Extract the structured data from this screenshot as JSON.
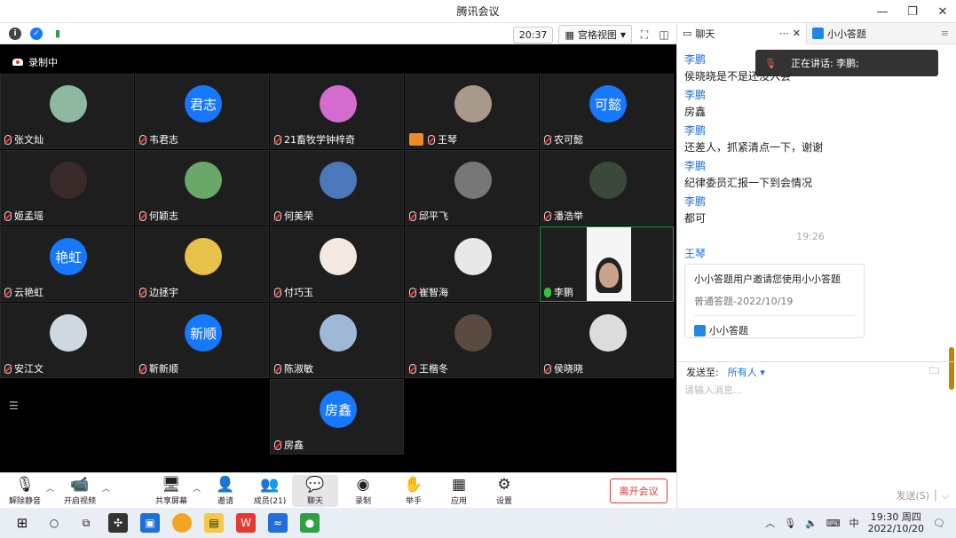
{
  "window": {
    "title": "腾讯会议"
  },
  "toolbar": {
    "time": "20:37",
    "view_label": "宫格视图"
  },
  "recording": {
    "label": "录制中"
  },
  "participants": [
    {
      "name": "张文灿",
      "avatar_text": "",
      "avatar_color": "#8fb8a0"
    },
    {
      "name": "韦君志",
      "avatar_text": "君志",
      "avatar_color": "#1677ff"
    },
    {
      "name": "21畜牧学钟梓奇",
      "avatar_text": "",
      "avatar_color": "#d46bcf"
    },
    {
      "name": "王琴",
      "avatar_text": "",
      "avatar_color": "#a89a8a"
    },
    {
      "name": "农可懿",
      "avatar_text": "可懿",
      "avatar_color": "#1677ff"
    },
    {
      "name": "姬孟瑶",
      "avatar_text": "",
      "avatar_color": "#3a2a2a"
    },
    {
      "name": "何颖志",
      "avatar_text": "",
      "avatar_color": "#6aa86a"
    },
    {
      "name": "何美荣",
      "avatar_text": "",
      "avatar_color": "#4a78b8"
    },
    {
      "name": "邱平飞",
      "avatar_text": "",
      "avatar_color": "#777777"
    },
    {
      "name": "潘浩举",
      "avatar_text": "",
      "avatar_color": "#3a4a3a"
    },
    {
      "name": "云艳虹",
      "avatar_text": "艳虹",
      "avatar_color": "#1677ff"
    },
    {
      "name": "边拯宇",
      "avatar_text": "",
      "avatar_color": "#e6c24a"
    },
    {
      "name": "付巧玉",
      "avatar_text": "",
      "avatar_color": "#f3e9e0"
    },
    {
      "name": "崔智海",
      "avatar_text": "",
      "avatar_color": "#e8e8e8"
    },
    {
      "name": "李鹏",
      "avatar_text": "",
      "avatar_color": "#f5f5f5"
    },
    {
      "name": "安江文",
      "avatar_text": "",
      "avatar_color": "#cfd8e0"
    },
    {
      "name": "靳新顺",
      "avatar_text": "新顺",
      "avatar_color": "#1677ff"
    },
    {
      "name": "陈淑敏",
      "avatar_text": "",
      "avatar_color": "#9fb8d8"
    },
    {
      "name": "王楷冬",
      "avatar_text": "",
      "avatar_color": "#5a4a40"
    },
    {
      "name": "侯晓晓",
      "avatar_text": "",
      "avatar_color": "#dcdcdc"
    },
    {
      "name": "房鑫",
      "avatar_text": "房鑫",
      "avatar_color": "#1677ff"
    }
  ],
  "controls": {
    "unmute": "解除静音",
    "start_video": "开启视频",
    "share_screen": "共享屏幕",
    "invite": "邀请",
    "members": "成员(21)",
    "chat": "聊天",
    "record": "录制",
    "raise_hand": "举手",
    "apps": "应用",
    "settings": "设置",
    "leave": "离开会议"
  },
  "chat": {
    "tab_chat": "聊天",
    "tab_quiz": "小小答题",
    "speaking_label": "正在讲话: 李鹏;",
    "messages": [
      {
        "sender": "李鹏",
        "text": "侯晓晓是不是还没入会"
      },
      {
        "sender": "李鹏",
        "text": "房鑫"
      },
      {
        "sender": "李鹏",
        "text": "还差人，抓紧清点一下，谢谢"
      },
      {
        "sender": "李鹏",
        "text": "纪律委员汇报一下到会情况"
      },
      {
        "sender": "李鹏",
        "text": "都可"
      }
    ],
    "divider_time": "19:26",
    "card_sender": "王琴",
    "card": {
      "title": "小小答题用户邀请您使用小小答题",
      "subtitle": "普通答题-2022/10/19",
      "app": "小小答题"
    },
    "send_to_label": "发送至:",
    "send_to_value": "所有人",
    "input_placeholder": "请输入消息...",
    "send_button": "发送(S)"
  },
  "taskbar": {
    "ime": "中",
    "clock_time": "19:30 周四",
    "clock_date": "2022/10/20"
  }
}
